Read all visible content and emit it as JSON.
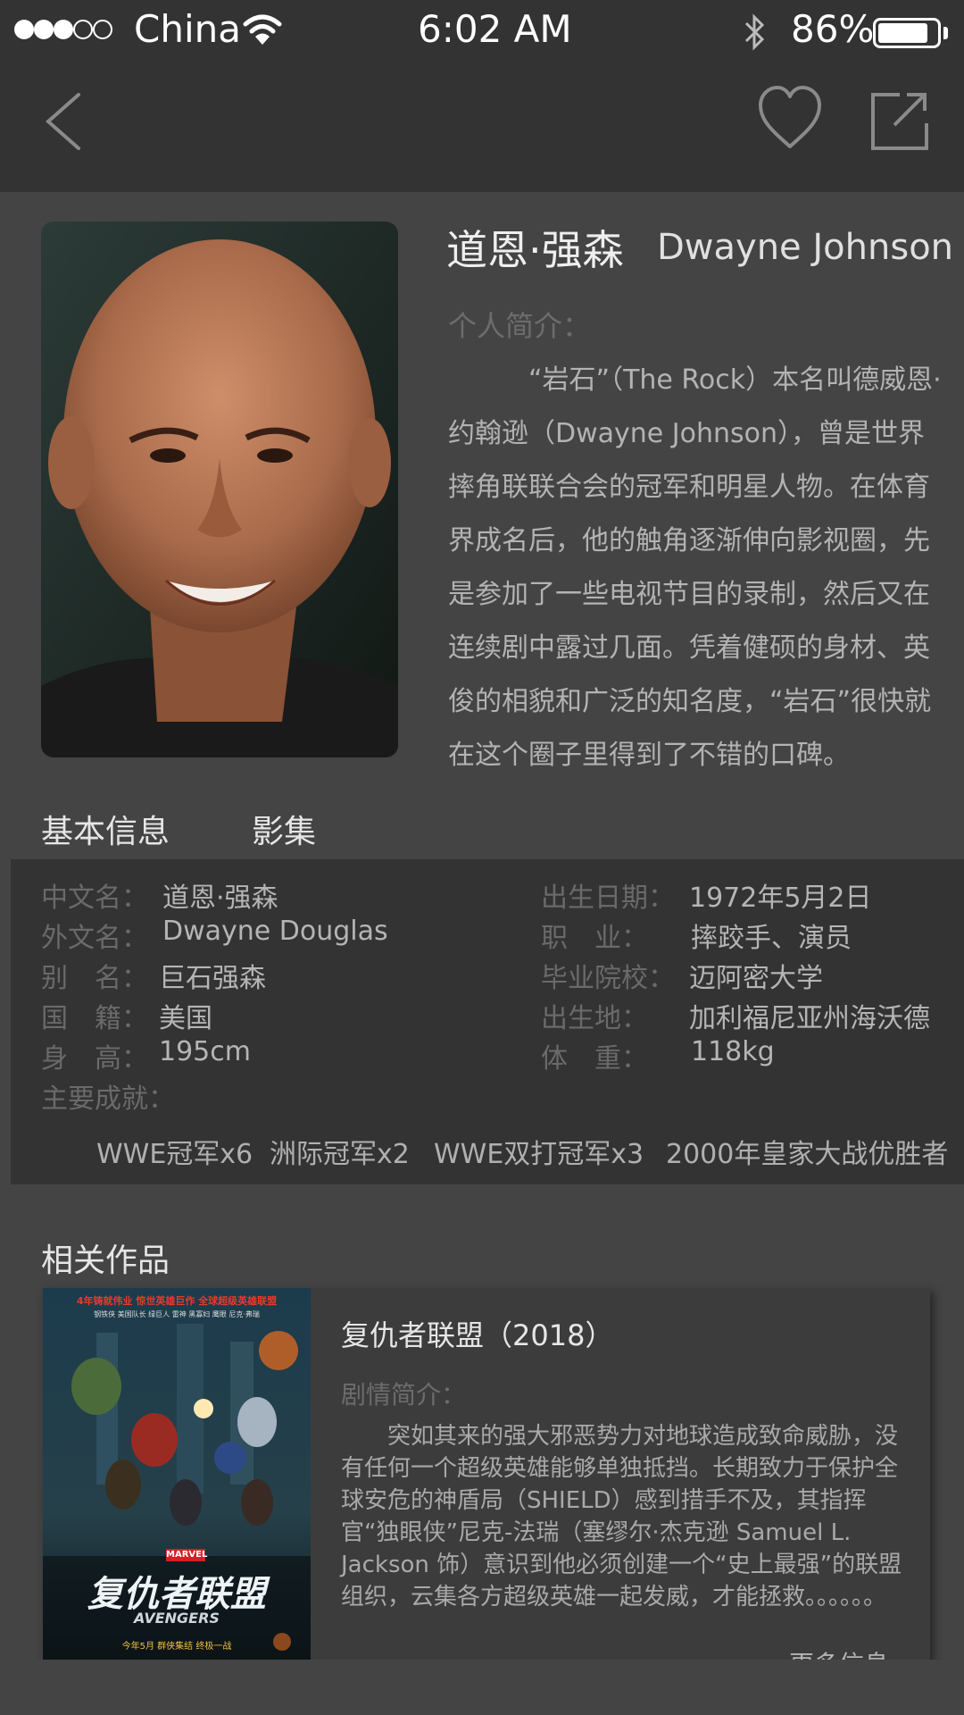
{
  "status_bar": {
    "carrier": "China",
    "time": "6:02 AM",
    "battery_percent": "86%",
    "battery_level": 0.86,
    "signal_strength": 3,
    "signal_max": 5
  },
  "nav": {
    "back_icon": "chevron-left-icon",
    "favorite_icon": "heart-icon",
    "share_icon": "share-icon"
  },
  "profile": {
    "name_cn": "道恩·强森",
    "name_en": "Dwayne Johnson",
    "bio_label": "个人简介：",
    "bio": "“岩石”（The Rock）本名叫德威恩·约翰逊（Dwayne Johnson），曾是世界摔角联联合会的冠军和明星人物。在体育界成名后，他的触角逐渐伸向影视圈，先是参加了一些电视节目的录制，然后又在连续剧中露过几面。凭着健硕的身材、英俊的相貌和广泛的知名度，“岩石”很快就在这个圈子里得到了不错的口碑。"
  },
  "tabs": [
    {
      "label": "基本信息",
      "active": true
    },
    {
      "label": "影集",
      "active": false
    }
  ],
  "basic_info": {
    "left": [
      {
        "label": "中文名：",
        "value": "道恩·强森"
      },
      {
        "label": "外文名：",
        "value": "Dwayne Douglas"
      },
      {
        "label": "别　名：",
        "value": "巨石强森"
      },
      {
        "label": "国　籍：",
        "value": "美国"
      },
      {
        "label": "身　高：",
        "value": "195cm"
      }
    ],
    "right": [
      {
        "label": "出生日期：",
        "value": "1972年5月2日"
      },
      {
        "label": "职　业：",
        "value": "摔跤手、演员"
      },
      {
        "label": "毕业院校：",
        "value": "迈阿密大学"
      },
      {
        "label": "出生地：",
        "value": "加利福尼亚州海沃德"
      },
      {
        "label": "体　重：",
        "value": "118kg"
      }
    ],
    "achievements_label": "主要成就：",
    "achievements": [
      "WWE冠军x6",
      "洲际冠军x2",
      "WWE双打冠军x3",
      "2000年皇家大战优胜者"
    ]
  },
  "related": {
    "title": "相关作品",
    "works": [
      {
        "title": "复仇者联盟（2018）",
        "synopsis_label": "剧情简介：",
        "synopsis": "突如其来的强大邪恶势力对地球造成致命威胁，没有任何一个超级英雄能够单独抵挡。长期致力于保护全球安危的神盾局（SHIELD）感到措手不及，其指挥官“独眼侠”尼克-法瑞（塞缪尔·杰克逊 Samuel L. Jackson 饰）意识到他必须创建一个“史上最强”的联盟组织，云集各方超级英雄一起发威，才能拯救。。。。。。",
        "more_label": "更多信息",
        "poster": {
          "tagline": "4年铸就伟业 惊世英雄巨作 全球超级英雄联盟",
          "heroes": "钢铁侠 美国队长 绿巨人 雷神 黑寡妇 鹰眼 尼克·弗瑞",
          "marvel": "MARVEL",
          "title_cn": "复仇者联盟",
          "title_en": "AVENGERS",
          "release": "今年5月 群侠集结 终极一战"
        }
      }
    ]
  },
  "colors": {
    "background": "#444444",
    "bars": "#333333",
    "panel": "#333333"
  }
}
